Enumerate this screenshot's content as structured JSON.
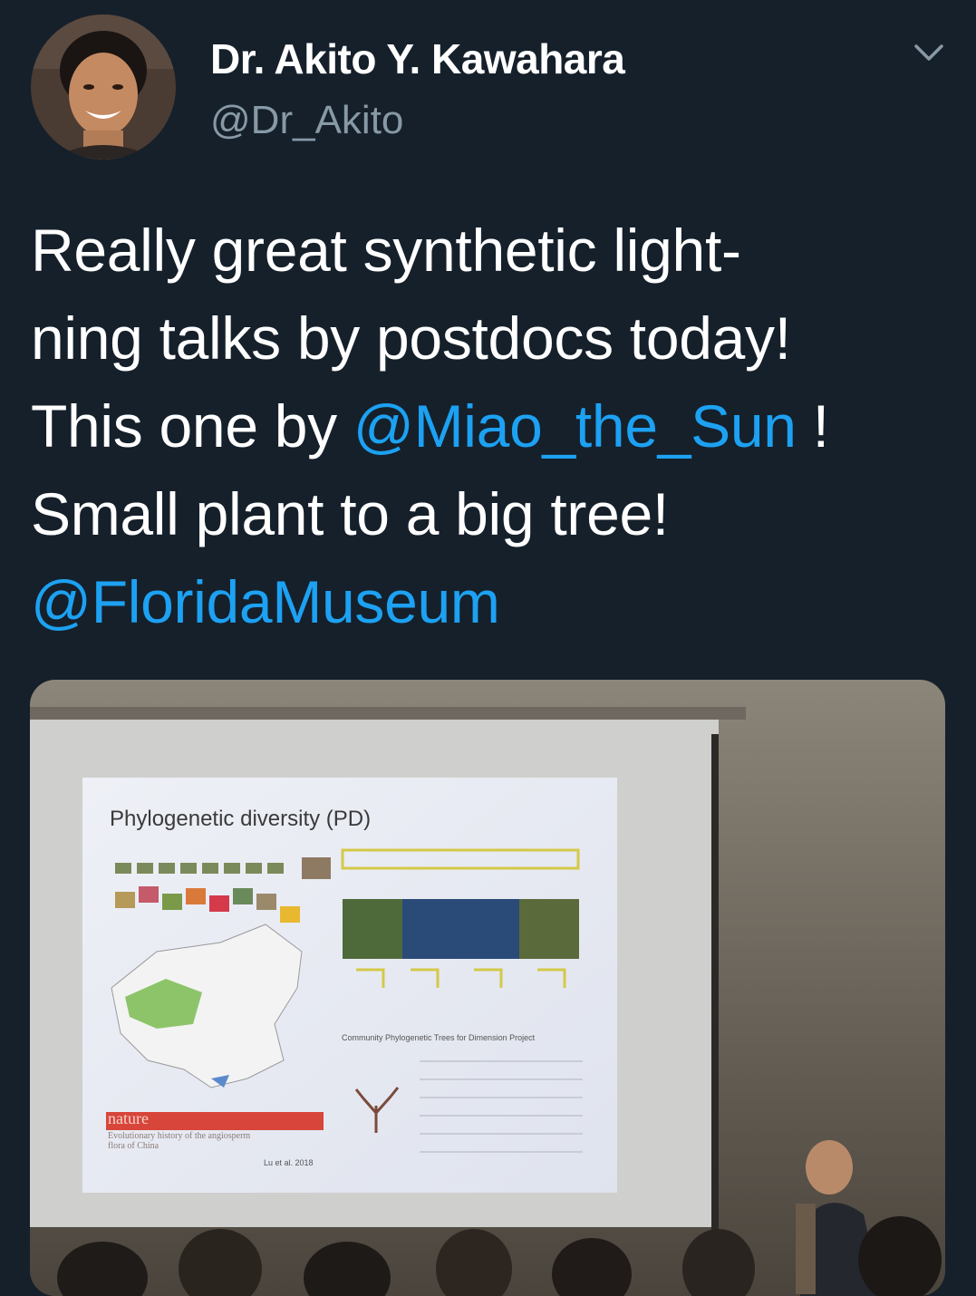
{
  "tweet": {
    "author": {
      "display_name": "Dr. Akito Y. Kawahara",
      "handle": "@Dr_Akito",
      "avatar_icon": "profile-photo"
    },
    "menu_icon": "chevron-down-icon",
    "text": {
      "line1": "Really great synthetic light-",
      "line2": "ning talks by postdocs today!",
      "line3_prefix": "This one by ",
      "line3_mention": "@Miao_the_Sun",
      "line3_suffix": " !",
      "line4": "Small plant to a big tree!",
      "line5_mention": "@FloridaMuseum"
    },
    "media": {
      "slide_title": "Phylogenetic diversity (PD)",
      "slide_caption": "Community Phylogenetic Trees for Dimension Project",
      "journal": "nature",
      "journal_subtitle_1": "Evolutionary history of the angiosperm",
      "journal_subtitle_2": "flora of China",
      "citation": "Lu et al. 2018"
    }
  },
  "colors": {
    "background": "#15202b",
    "text": "#ffffff",
    "muted": "#8899a6",
    "link": "#1da1f2"
  }
}
